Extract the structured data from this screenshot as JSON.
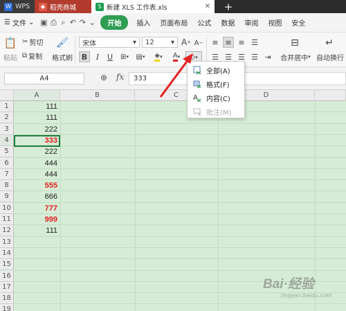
{
  "tabbar": {
    "app_name": "WPS",
    "store_tab": "稻壳商城",
    "document_tab": "新建 XLS 工作表.xls",
    "new_tab": "+"
  },
  "menu": {
    "file": "文件",
    "items": [
      "开始",
      "插入",
      "页面布局",
      "公式",
      "数据",
      "审阅",
      "视图",
      "安全"
    ]
  },
  "ribbon": {
    "cut": "剪切",
    "copy": "复制",
    "paste": "粘贴",
    "format_painter": "格式刷",
    "font_name": "宋体",
    "font_size": "12",
    "merge_center": "合并居中",
    "auto_wrap": "自动换行",
    "bold": "B",
    "italic": "I",
    "underline": "U",
    "font_color_letter": "A",
    "grow_font": "A",
    "shrink_font": "A"
  },
  "formula_bar": {
    "name_box": "A4",
    "fx": "fx",
    "formula": "333"
  },
  "sheet": {
    "columns": [
      "A",
      "B",
      "C",
      "D"
    ],
    "rows": [
      "1",
      "2",
      "3",
      "4",
      "5",
      "6",
      "7",
      "8",
      "9",
      "10",
      "11",
      "12",
      "13",
      "14",
      "15",
      "16",
      "17",
      "18",
      "19"
    ],
    "cells": [
      {
        "value": "111",
        "red": false
      },
      {
        "value": "111",
        "red": false
      },
      {
        "value": "222",
        "red": false
      },
      {
        "value": "333",
        "red": true
      },
      {
        "value": "222",
        "red": false
      },
      {
        "value": "444",
        "red": false
      },
      {
        "value": "444",
        "red": false
      },
      {
        "value": "555",
        "red": true
      },
      {
        "value": "666",
        "red": false
      },
      {
        "value": "777",
        "red": true
      },
      {
        "value": "999",
        "red": true
      },
      {
        "value": "111",
        "red": false
      }
    ],
    "active_cell": "A4"
  },
  "clear_menu": {
    "items": [
      {
        "label": "全部(A)",
        "enabled": true
      },
      {
        "label": "格式(F)",
        "enabled": true
      },
      {
        "label": "内容(C)",
        "enabled": true
      },
      {
        "label": "批注(M)",
        "enabled": false
      }
    ]
  },
  "watermark": {
    "main": "Bai·经验",
    "sub": "jingyan.baidu.com"
  },
  "colors": {
    "accent": "#2e9e52",
    "highlight_text": "#e02020",
    "sheet_background": "#d6ecd6",
    "arrow": "#e32222"
  }
}
